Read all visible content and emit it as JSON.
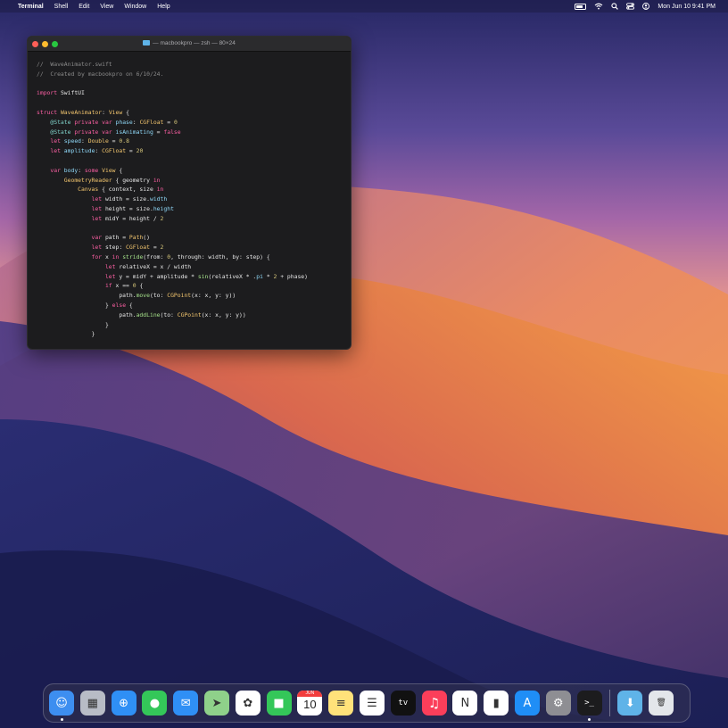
{
  "menubar": {
    "app_name": "Terminal",
    "menus": [
      "Shell",
      "Edit",
      "View",
      "Window",
      "Help"
    ],
    "clock": "Mon Jun 10  9:41 PM",
    "icons": [
      "apple-logo-icon",
      "battery-icon",
      "wifi-icon",
      "search-icon",
      "control-center-icon",
      "user-icon"
    ]
  },
  "terminal": {
    "title": "— macbookpro — zsh — 80×24",
    "lines": [
      [
        {
          "t": "//  WaveAnimator.swift",
          "c": "comment"
        }
      ],
      [
        {
          "t": "//  Created by macbookpro on 6/10/24.",
          "c": "comment"
        }
      ],
      [],
      [
        {
          "t": "import",
          "c": "kw"
        },
        {
          "t": " SwiftUI",
          "c": ""
        }
      ],
      [],
      [
        {
          "t": "struct",
          "c": "kw"
        },
        {
          "t": " WaveAnimator",
          "c": "type"
        },
        {
          "t": ": ",
          "c": ""
        },
        {
          "t": "View",
          "c": "type"
        },
        {
          "t": " {",
          "c": ""
        }
      ],
      [
        {
          "t": "    @State",
          "c": "attr"
        },
        {
          "t": " private",
          "c": "kw"
        },
        {
          "t": " var",
          "c": "kw"
        },
        {
          "t": " phase",
          "c": "prop"
        },
        {
          "t": ": ",
          "c": ""
        },
        {
          "t": "CGFloat",
          "c": "type"
        },
        {
          "t": " = ",
          "c": ""
        },
        {
          "t": "0",
          "c": "num"
        }
      ],
      [
        {
          "t": "    @State",
          "c": "attr"
        },
        {
          "t": " private",
          "c": "kw"
        },
        {
          "t": " var",
          "c": "kw"
        },
        {
          "t": " isAnimating",
          "c": "prop"
        },
        {
          "t": " = ",
          "c": ""
        },
        {
          "t": "false",
          "c": "kw"
        }
      ],
      [
        {
          "t": "    let",
          "c": "kw"
        },
        {
          "t": " speed",
          "c": "prop"
        },
        {
          "t": ": ",
          "c": ""
        },
        {
          "t": "Double",
          "c": "type"
        },
        {
          "t": " = ",
          "c": ""
        },
        {
          "t": "0.8",
          "c": "num"
        }
      ],
      [
        {
          "t": "    let",
          "c": "kw"
        },
        {
          "t": " amplitude",
          "c": "prop"
        },
        {
          "t": ": ",
          "c": ""
        },
        {
          "t": "CGFloat",
          "c": "type"
        },
        {
          "t": " = ",
          "c": ""
        },
        {
          "t": "20",
          "c": "num"
        }
      ],
      [],
      [
        {
          "t": "    var",
          "c": "kw"
        },
        {
          "t": " body",
          "c": "prop"
        },
        {
          "t": ": ",
          "c": ""
        },
        {
          "t": "some",
          "c": "kw"
        },
        {
          "t": " View",
          "c": "type"
        },
        {
          "t": " {",
          "c": ""
        }
      ],
      [
        {
          "t": "        GeometryReader",
          "c": "type"
        },
        {
          "t": " { geometry ",
          "c": ""
        },
        {
          "t": "in",
          "c": "kw"
        }
      ],
      [
        {
          "t": "            Canvas",
          "c": "type"
        },
        {
          "t": " { context, size ",
          "c": ""
        },
        {
          "t": "in",
          "c": "kw"
        }
      ],
      [
        {
          "t": "                let",
          "c": "kw"
        },
        {
          "t": " width = size.",
          "c": ""
        },
        {
          "t": "width",
          "c": "prop"
        }
      ],
      [
        {
          "t": "                let",
          "c": "kw"
        },
        {
          "t": " height = size.",
          "c": ""
        },
        {
          "t": "height",
          "c": "prop"
        }
      ],
      [
        {
          "t": "                let",
          "c": "kw"
        },
        {
          "t": " midY = height / ",
          "c": ""
        },
        {
          "t": "2",
          "c": "num"
        }
      ],
      [],
      [
        {
          "t": "                var",
          "c": "kw"
        },
        {
          "t": " path = ",
          "c": ""
        },
        {
          "t": "Path",
          "c": "type"
        },
        {
          "t": "()",
          "c": ""
        }
      ],
      [
        {
          "t": "                let",
          "c": "kw"
        },
        {
          "t": " step: ",
          "c": ""
        },
        {
          "t": "CGFloat",
          "c": "type"
        },
        {
          "t": " = ",
          "c": ""
        },
        {
          "t": "2",
          "c": "num"
        }
      ],
      [
        {
          "t": "                for",
          "c": "kw"
        },
        {
          "t": " x ",
          "c": ""
        },
        {
          "t": "in",
          "c": "kw"
        },
        {
          "t": " stride",
          "c": "fn"
        },
        {
          "t": "(from: ",
          "c": ""
        },
        {
          "t": "0",
          "c": "num"
        },
        {
          "t": ", through: width, by: step) {",
          "c": ""
        }
      ],
      [
        {
          "t": "                    let",
          "c": "kw"
        },
        {
          "t": " relativeX = x / width",
          "c": ""
        }
      ],
      [
        {
          "t": "                    let",
          "c": "kw"
        },
        {
          "t": " y = midY + amplitude * ",
          "c": ""
        },
        {
          "t": "sin",
          "c": "fn"
        },
        {
          "t": "(relativeX * .",
          "c": ""
        },
        {
          "t": "pi",
          "c": "prop"
        },
        {
          "t": " * ",
          "c": ""
        },
        {
          "t": "2",
          "c": "num"
        },
        {
          "t": " + phase)",
          "c": ""
        }
      ],
      [
        {
          "t": "                    if",
          "c": "kw"
        },
        {
          "t": " x == ",
          "c": ""
        },
        {
          "t": "0",
          "c": "num"
        },
        {
          "t": " {",
          "c": ""
        }
      ],
      [
        {
          "t": "                        path.",
          "c": ""
        },
        {
          "t": "move",
          "c": "fn"
        },
        {
          "t": "(to: ",
          "c": ""
        },
        {
          "t": "CGPoint",
          "c": "type"
        },
        {
          "t": "(x: x, y: y))",
          "c": ""
        }
      ],
      [
        {
          "t": "                    } ",
          "c": ""
        },
        {
          "t": "else",
          "c": "kw"
        },
        {
          "t": " {",
          "c": ""
        }
      ],
      [
        {
          "t": "                        path.",
          "c": ""
        },
        {
          "t": "addLine",
          "c": "fn"
        },
        {
          "t": "(to: ",
          "c": ""
        },
        {
          "t": "CGPoint",
          "c": "type"
        },
        {
          "t": "(x: x, y: y))",
          "c": ""
        }
      ],
      [
        {
          "t": "                    }",
          "c": ""
        }
      ],
      [
        {
          "t": "                }",
          "c": ""
        }
      ]
    ]
  },
  "dock": {
    "apps": [
      {
        "name": "Finder",
        "icon": "finder-icon",
        "bg": "#3d8ef0",
        "glyph": "☺",
        "running": true
      },
      {
        "name": "Launchpad",
        "icon": "launchpad-icon",
        "bg": "#b8bcc6",
        "glyph": "▦",
        "running": false
      },
      {
        "name": "Safari",
        "icon": "safari-icon",
        "bg": "#2f8ff5",
        "glyph": "⊕",
        "running": false
      },
      {
        "name": "Messages",
        "icon": "messages-icon",
        "bg": "#34c759",
        "glyph": "●",
        "running": false
      },
      {
        "name": "Mail",
        "icon": "mail-icon",
        "bg": "#2f8ff5",
        "glyph": "✉",
        "running": false
      },
      {
        "name": "Maps",
        "icon": "maps-icon",
        "bg": "#8fd18a",
        "glyph": "➤",
        "running": false
      },
      {
        "name": "Photos",
        "icon": "photos-icon",
        "bg": "#ffffff",
        "glyph": "✿",
        "running": false
      },
      {
        "name": "FaceTime",
        "icon": "facetime-icon",
        "bg": "#34c759",
        "glyph": "■",
        "running": false
      },
      {
        "name": "Calendar",
        "icon": "calendar-icon",
        "bg": "#ffffff",
        "glyph": "10",
        "month": "JUN",
        "running": false
      },
      {
        "name": "Notes",
        "icon": "notes-icon",
        "bg": "#ffe27a",
        "glyph": "≡",
        "running": false
      },
      {
        "name": "Reminders",
        "icon": "reminders-icon",
        "bg": "#ffffff",
        "glyph": "☰",
        "running": false
      },
      {
        "name": "TV",
        "icon": "apple-tv-icon",
        "bg": "#111111",
        "glyph": "tv",
        "running": false
      },
      {
        "name": "Music",
        "icon": "music-icon",
        "bg": "#fb3e5a",
        "glyph": "♫",
        "running": false
      },
      {
        "name": "News",
        "icon": "news-icon",
        "bg": "#ffffff",
        "glyph": "N",
        "running": false
      },
      {
        "name": "Numbers",
        "icon": "numbers-icon",
        "bg": "#ffffff",
        "glyph": "▮",
        "running": false
      },
      {
        "name": "App Store",
        "icon": "app-store-icon",
        "bg": "#1f8ef6",
        "glyph": "A",
        "running": false
      },
      {
        "name": "System Settings",
        "icon": "system-settings-icon",
        "bg": "#8e8e93",
        "glyph": "⚙",
        "running": false
      },
      {
        "name": "Terminal",
        "icon": "terminal-icon",
        "bg": "#1c1c1e",
        "glyph": ">_",
        "running": true
      }
    ],
    "extras": [
      {
        "name": "Downloads",
        "icon": "downloads-folder-icon",
        "bg": "#5fb3e8",
        "glyph": "⬇"
      },
      {
        "name": "Trash",
        "icon": "trash-icon",
        "bg": "#e3e6ea",
        "glyph": "🗑"
      }
    ]
  }
}
